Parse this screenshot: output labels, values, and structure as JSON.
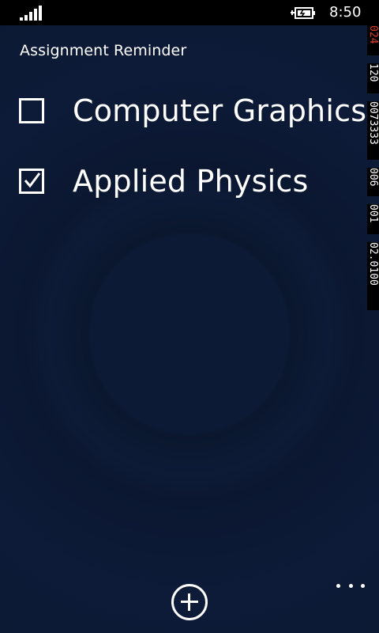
{
  "status_bar": {
    "time": "8:50",
    "signal_icon": "signal-bars-icon",
    "battery_icon": "battery-charging-icon"
  },
  "app": {
    "title": "Assignment Reminder"
  },
  "tasks": [
    {
      "label": "Computer Graphics",
      "checked": false
    },
    {
      "label": "Applied Physics",
      "checked": true
    }
  ],
  "debug_counters": [
    "024",
    "120",
    "0073333",
    "006",
    "001",
    "02.0100"
  ],
  "app_bar": {
    "add_icon": "add-circle-icon",
    "more_icon": "more-dots-icon"
  },
  "colors": {
    "background": "#0d1b38",
    "status_bar": "#000000",
    "debug_red": "#e03b2b"
  }
}
